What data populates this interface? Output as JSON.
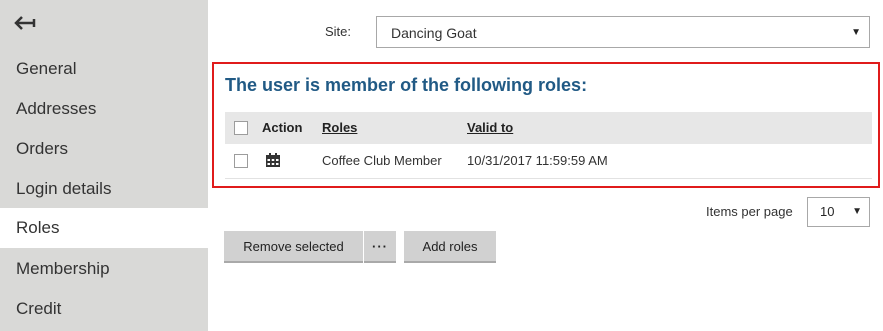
{
  "sidebar": {
    "items": [
      {
        "label": "General"
      },
      {
        "label": "Addresses"
      },
      {
        "label": "Orders"
      },
      {
        "label": "Login details"
      },
      {
        "label": "Roles",
        "active": true
      },
      {
        "label": "Membership"
      },
      {
        "label": "Credit"
      }
    ]
  },
  "site": {
    "label": "Site:",
    "value": "Dancing Goat"
  },
  "roles_panel": {
    "title": "The user is member of the following roles:",
    "columns": {
      "action": "Action",
      "roles": "Roles",
      "valid_to": "Valid to"
    },
    "rows": [
      {
        "role": "Coffee Club Member",
        "valid_to": "10/31/2017 11:59:59 AM"
      }
    ]
  },
  "pagination": {
    "items_per_page_label": "Items per page",
    "items_per_page_value": "10"
  },
  "actions": {
    "remove_selected": "Remove selected",
    "more": "···",
    "add_roles": "Add roles"
  },
  "colors": {
    "sidebar_bg": "#d9d9d7",
    "title": "#215a85",
    "highlight_border": "#e01b1b",
    "button_bg": "#d1d1d1"
  },
  "icons": {
    "back": "back-arrow-icon",
    "calendar": "calendar-icon",
    "dropdown": "triangle-down-icon"
  }
}
